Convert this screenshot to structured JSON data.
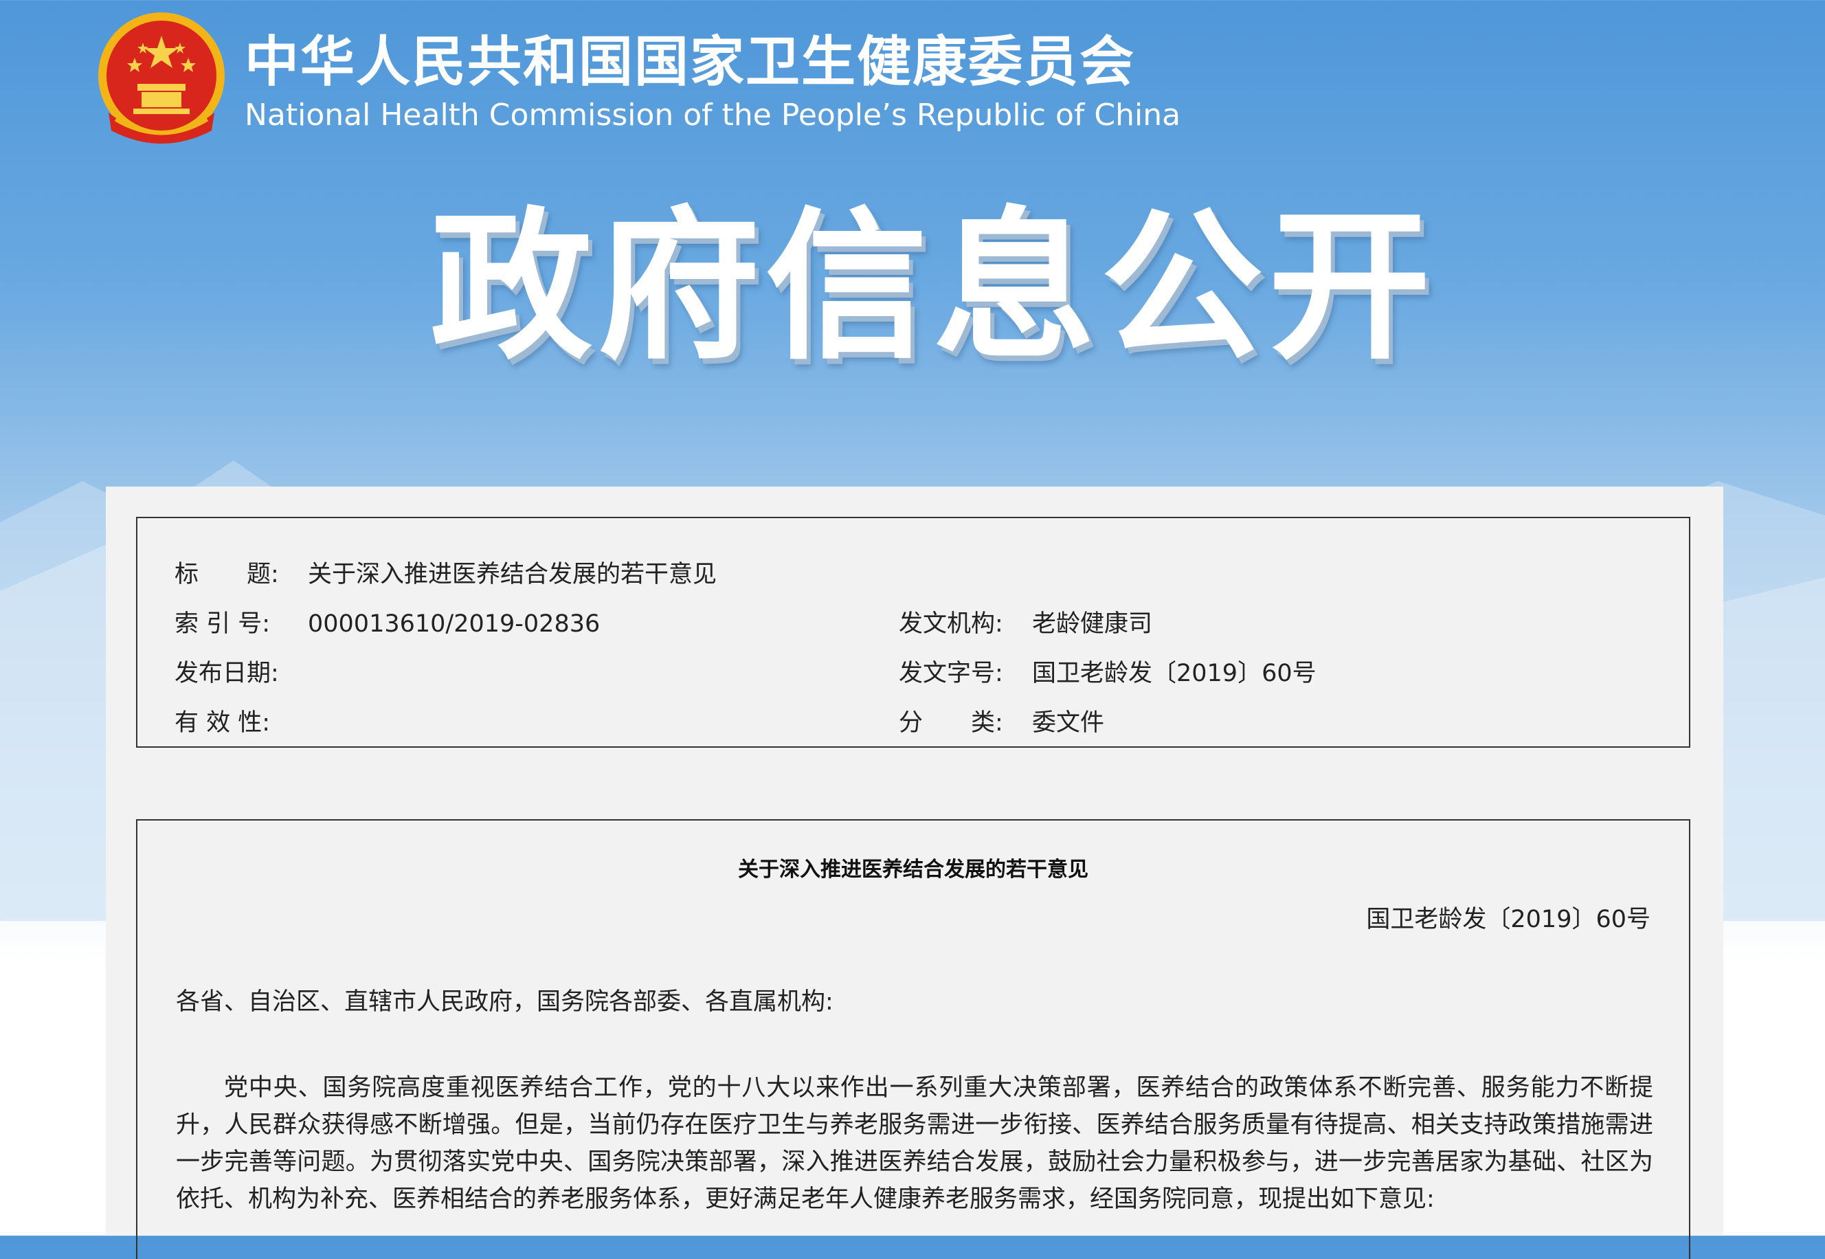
{
  "header": {
    "org_name_cn": "中华人民共和国国家卫生健康委员会",
    "org_name_en": "National Health Commission of the People’s  Republic of China",
    "banner_title": "政府信息公开",
    "emblem_icon": "national-emblem-icon"
  },
  "meta": {
    "title_label": "标　　题:",
    "title_value": "关于深入推进医养结合发展的若干意见",
    "index_label": "索 引 号:",
    "index_value": "000013610/2019-02836",
    "issuer_label": "发文机构:",
    "issuer_value": "老龄健康司",
    "date_label": "发布日期:",
    "date_value": "",
    "doc_no_label": "发文字号:",
    "doc_no_value": "国卫老龄发〔2019〕60号",
    "validity_label": "有 效 性:",
    "validity_value": "",
    "category_label": "分　　类:",
    "category_value": "委文件"
  },
  "document": {
    "title": "关于深入推进医养结合发展的若干意见",
    "number": "国卫老龄发〔2019〕60号",
    "salutation": "各省、自治区、直辖市人民政府，国务院各部委、各直属机构:",
    "paragraph_1": "党中央、国务院高度重视医养结合工作，党的十八大以来作出一系列重大决策部署，医养结合的政策体系不断完善、服务能力不断提升，人民群众获得感不断增强。但是，当前仍存在医疗卫生与养老服务需进一步衔接、医养结合服务质量有待提高、相关支持政策措施需进一步完善等问题。为贯彻落实党中央、国务院决策部署，深入推进医养结合发展，鼓励社会力量积极参与，进一步完善居家为基础、社区为依托、机构为补充、医养相结合的养老服务体系，更好满足老年人健康养老服务需求，经国务院同意，现提出如下意见:"
  },
  "colors": {
    "sky_top": "#4f97d9",
    "sky_mid": "#a9cdec",
    "panel": "#f2f2f2",
    "border": "#333333",
    "emblem_red": "#d8261c",
    "emblem_gold": "#f2b417"
  }
}
